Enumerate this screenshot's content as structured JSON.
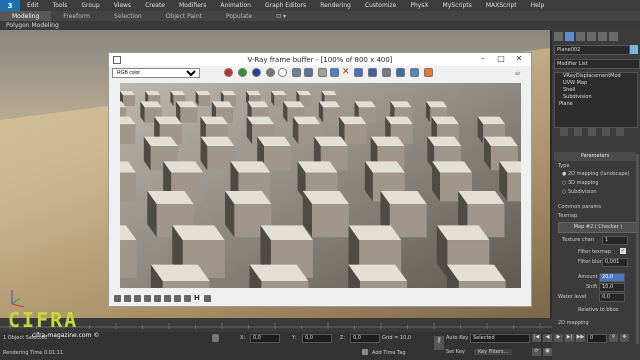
{
  "menu": {
    "app_button": "3",
    "items": [
      "Edit",
      "Tools",
      "Group",
      "Views",
      "Create",
      "Modifiers",
      "Animation",
      "Graph Editors",
      "Rendering",
      "Customize",
      "PhysX",
      "MyScripts",
      "MAXScript",
      "Help"
    ]
  },
  "ribbon": {
    "tabs": [
      "Modeling",
      "Freeform",
      "Selection",
      "Object Paint",
      "Populate"
    ],
    "active": "Modeling",
    "sub_label": "Polygon Modeling"
  },
  "vfb": {
    "title": "V-Ray frame buffer - [100% of 800 x 400]",
    "channel": "RGB color",
    "colors": {
      "red": "#c0302a",
      "green": "#2e8f36",
      "blue": "#263e9c",
      "mono": "#777777",
      "white": "#ffffff"
    }
  },
  "panel": {
    "object_name": "Plane002",
    "modifier_list": "Modifier List",
    "stack": [
      "VRayDisplacementMod",
      "UVW Map",
      "Shell",
      "Subdivision",
      "Plane"
    ],
    "rollout": "Parameters",
    "type_label": "Type",
    "type_options": [
      "2D mapping (landscape)",
      "3D mapping",
      "Subdivision"
    ],
    "common_params": "Common params",
    "texmap_label": "Texmap",
    "texmap_value": "Map #2  ( Checker )",
    "texture_chan_label": "Texture chan",
    "texture_chan_value": "1",
    "filter_texmap_label": "Filter texmap",
    "filter_blur_label": "Filter blur",
    "filter_blur_value": "0,001",
    "amount_label": "Amount",
    "amount_value": "20,0",
    "shift_label": "Shift",
    "shift_value": "10,0",
    "water_level_label": "Water level",
    "water_level_value": "0,0",
    "relative_bbox_label": "Relative to bbox",
    "mapping_label": "2D mapping"
  },
  "status": {
    "selection": "1 Object Selected",
    "render_time": "Rendering Time  0:01:11",
    "x_value": "0,0",
    "y_value": "0,0",
    "z_value": "0,0",
    "grid": "Grid = 10,0",
    "auto_key": "Auto Key",
    "selected": "Selected",
    "set_key": "Set Key",
    "key_filters": "Key Filters...",
    "add_time_tag": "Add Time Tag",
    "frame": "0"
  },
  "watermark": {
    "brand": "CIFRA",
    "site": "cifra-magazine.com ©"
  }
}
